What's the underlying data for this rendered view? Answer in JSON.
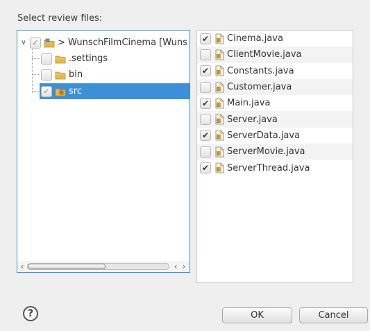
{
  "dialog": {
    "prompt": "Select review files:",
    "ok_label": "OK",
    "cancel_label": "Cancel",
    "help_glyph": "?"
  },
  "tree": {
    "root": {
      "label": "> WunschFilmCinema [Wuns",
      "checked": "partial",
      "expanded": true,
      "icon": "project-folder-icon"
    },
    "children": [
      {
        "label": ".settings",
        "checked": false,
        "icon": "folder-icon"
      },
      {
        "label": "bin",
        "checked": false,
        "icon": "folder-icon"
      },
      {
        "label": "src",
        "checked": "partial",
        "icon": "package-folder-icon",
        "selected": true
      }
    ]
  },
  "files": [
    {
      "label": "Cinema.java",
      "checked": true
    },
    {
      "label": "ClientMovie.java",
      "checked": false
    },
    {
      "label": "Constants.java",
      "checked": true
    },
    {
      "label": "Customer.java",
      "checked": false
    },
    {
      "label": "Main.java",
      "checked": true
    },
    {
      "label": "Server.java",
      "checked": false
    },
    {
      "label": "ServerData.java",
      "checked": true
    },
    {
      "label": "ServerMovie.java",
      "checked": false
    },
    {
      "label": "ServerThread.java",
      "checked": true
    }
  ],
  "colors": {
    "accent": "#3d8fd8",
    "folder": "#e8b84a"
  }
}
